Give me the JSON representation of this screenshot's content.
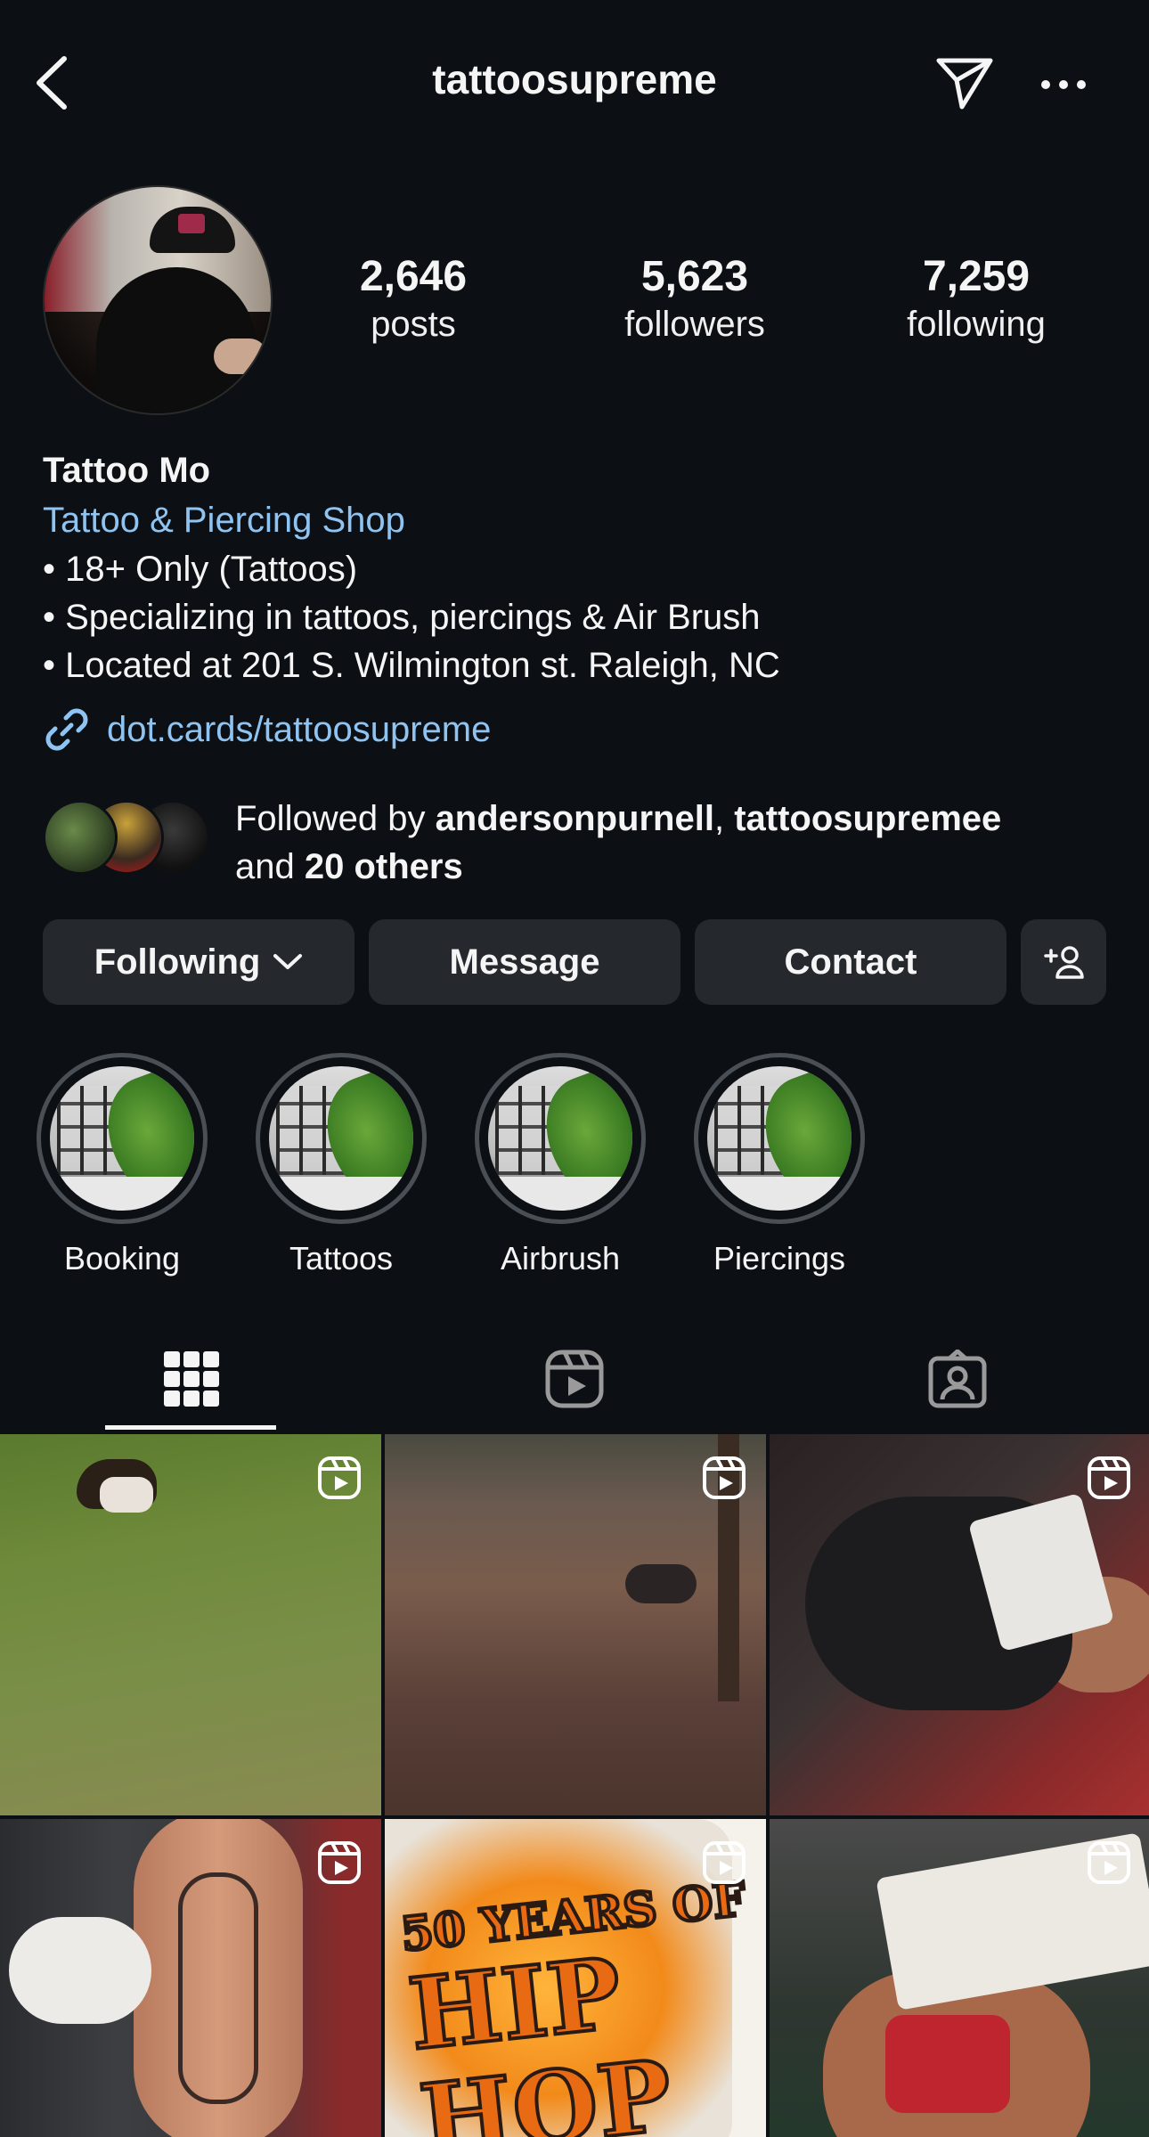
{
  "header": {
    "username": "tattoosupreme"
  },
  "profile": {
    "stats": [
      {
        "value": "2,646",
        "label": "posts"
      },
      {
        "value": "5,623",
        "label": "followers"
      },
      {
        "value": "7,259",
        "label": "following"
      }
    ],
    "name": "Tattoo Mo",
    "category": "Tattoo & Piercing Shop",
    "bio_lines": [
      "• 18+ Only (Tattoos)",
      "• Specializing in tattoos, piercings & Air Brush",
      "• Located at 201 S. Wilmington st. Raleigh, NC"
    ],
    "link": "dot.cards/tattoosupreme"
  },
  "followed_by": {
    "prefix": "Followed by ",
    "user1": "andersonpurnell",
    "separator": ", ",
    "user2": "tattoosupremee",
    "and": "and ",
    "others": "20 others"
  },
  "actions": {
    "following_label": "Following",
    "message_label": "Message",
    "contact_label": "Contact"
  },
  "highlights": [
    {
      "label": "Booking"
    },
    {
      "label": "Tattoos"
    },
    {
      "label": "Airbrush"
    },
    {
      "label": "Piercings"
    }
  ],
  "tabs": {
    "icons": [
      "grid-icon",
      "reels-icon",
      "tagged-icon"
    ],
    "active": "grid-icon"
  },
  "grid": {
    "tile5_art_text": [
      "50 YEARS OF",
      "HIP",
      "HOP"
    ]
  },
  "colors": {
    "background": "#0c1014",
    "link": "#8fc4f2",
    "button": "#25292e"
  }
}
